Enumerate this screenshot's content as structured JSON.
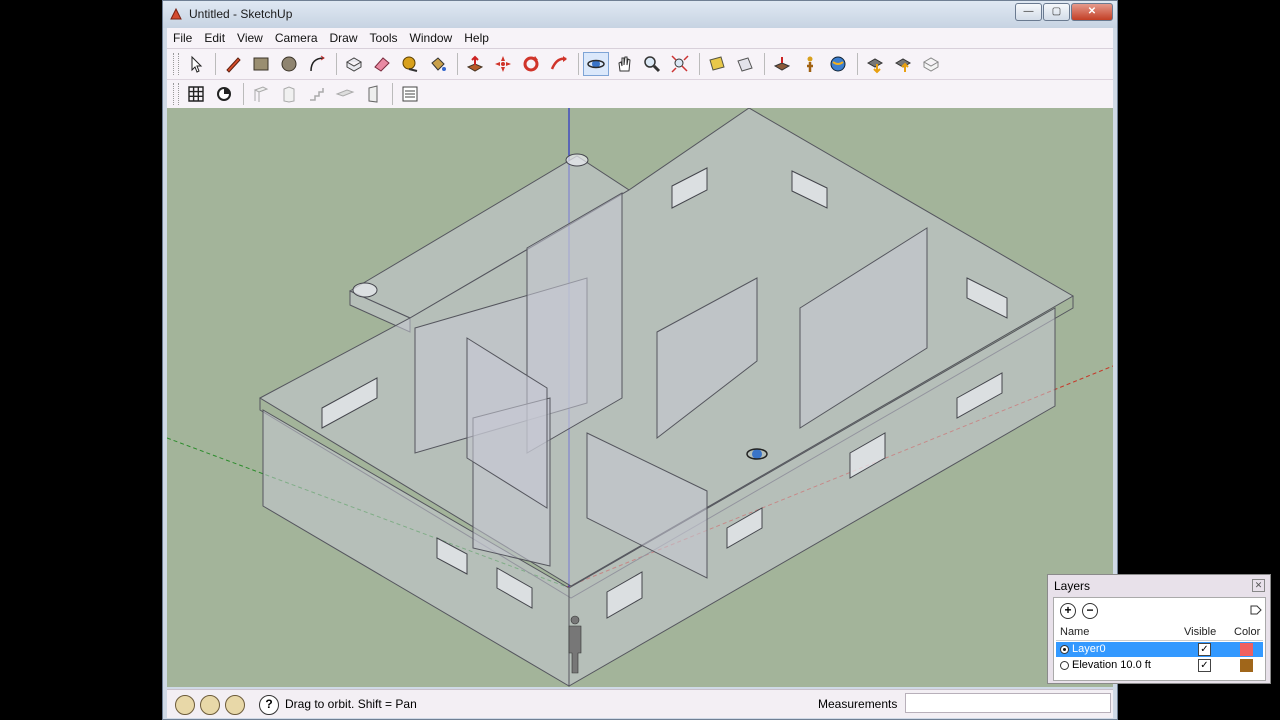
{
  "window": {
    "title": "Untitled - SketchUp"
  },
  "menu": [
    "File",
    "Edit",
    "View",
    "Camera",
    "Draw",
    "Tools",
    "Window",
    "Help"
  ],
  "toolbar_main": {
    "tools": [
      "select-icon",
      "pencil-icon",
      "rectangle-icon",
      "circle-icon",
      "arc-icon",
      "make-component-icon",
      "eraser-icon",
      "tape-measure-icon",
      "paint-bucket-icon",
      "push-pull-icon",
      "move-icon",
      "rotate-icon",
      "follow-me-icon",
      "orbit-icon",
      "pan-icon",
      "zoom-icon",
      "zoom-extents-icon",
      "section-plane-icon",
      "position-camera-icon",
      "walk-icon",
      "look-around-icon",
      "get-models-icon",
      "share-model-icon",
      "components-icon"
    ],
    "active": "orbit-icon"
  },
  "toolbar_secondary": {
    "tools": [
      "grid-icon",
      "sandbox-icon",
      "wall-icon",
      "column-icon",
      "stair-icon",
      "beam-icon",
      "door-icon",
      "layers-list-icon"
    ]
  },
  "status": {
    "hint": "Drag to orbit.  Shift = Pan",
    "measurements_label": "Measurements",
    "measurements_value": ""
  },
  "layers_panel": {
    "title": "Layers",
    "columns": {
      "name": "Name",
      "visible": "Visible",
      "color": "Color"
    },
    "rows": [
      {
        "name": "Layer0",
        "active": true,
        "visible": true,
        "color": "#f06060"
      },
      {
        "name": "Elevation 10.0 ft",
        "active": false,
        "visible": true,
        "color": "#a0661a"
      }
    ]
  },
  "colors": {
    "viewport_background": "#a3b49a",
    "wall_fill": "#c7c8d3",
    "axis_blue": "#2a33c8",
    "axis_green": "#2b8c2b",
    "axis_red": "#c63a2b",
    "selection": "#3399ff"
  }
}
